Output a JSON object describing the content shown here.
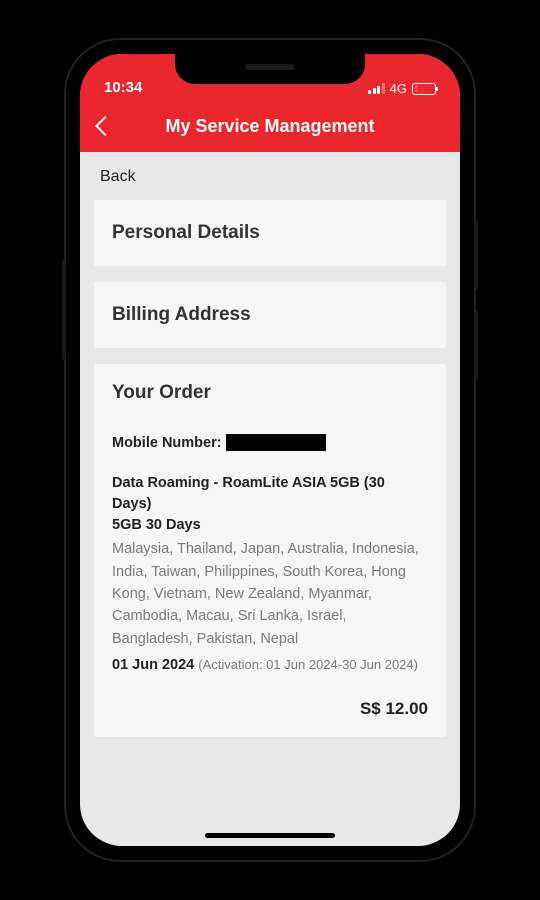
{
  "status": {
    "time": "10:34",
    "network": "4G"
  },
  "nav": {
    "title": "My Service Management"
  },
  "page": {
    "back_label": "Back"
  },
  "sections": {
    "personal": {
      "title": "Personal Details"
    },
    "billing": {
      "title": "Billing Address"
    },
    "order": {
      "title": "Your Order",
      "mobile_label": "Mobile Number:",
      "product_name_line1": "Data Roaming - RoamLite ASIA 5GB (30 Days)",
      "product_name_line2": "5GB 30 Days",
      "countries": "Malaysia, Thailand, Japan, Australia, Indonesia, India, Taiwan, Philippines, South Korea, Hong Kong, Vietnam, New Zealand, Myanmar, Cambodia, Macau, Sri Lanka, Israel, Bangladesh, Pakistan, Nepal",
      "date": "01 Jun 2024",
      "activation": "(Activation: 01 Jun 2024-30 Jun 2024)",
      "price": "S$ 12.00"
    }
  }
}
